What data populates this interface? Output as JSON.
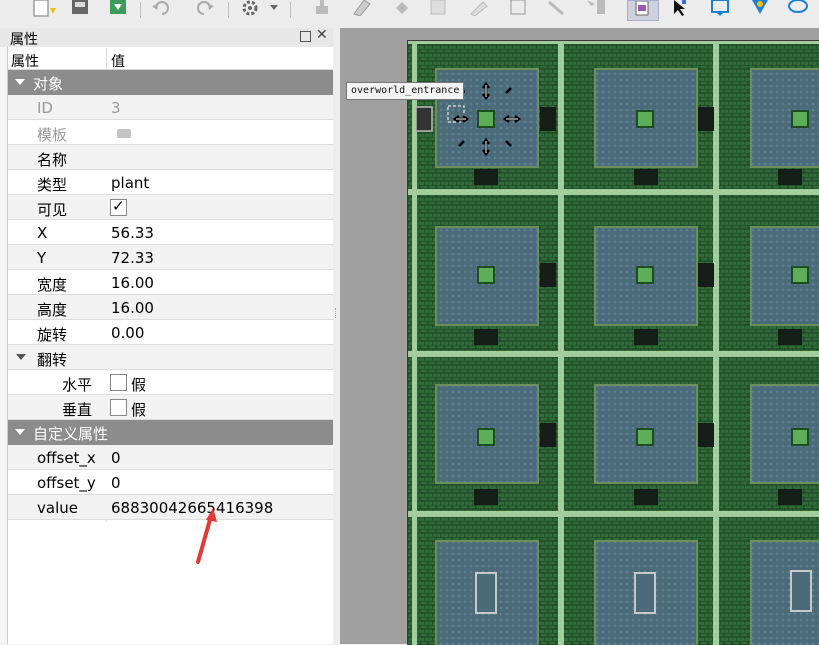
{
  "dock": {
    "title": "属性",
    "close_glyph": "✕",
    "header": {
      "prop": "属性",
      "value": "值"
    }
  },
  "groups": {
    "object": "对象",
    "flip": "翻转",
    "custom": "自定义属性"
  },
  "properties": {
    "id": {
      "name": "ID",
      "value": "3"
    },
    "template": {
      "name": "模板"
    },
    "name": {
      "name": "名称",
      "value": ""
    },
    "type": {
      "name": "类型",
      "value": "plant"
    },
    "visible": {
      "name": "可见",
      "checked": true
    },
    "x": {
      "name": "X",
      "value": "56.33"
    },
    "y": {
      "name": "Y",
      "value": "72.33"
    },
    "width": {
      "name": "宽度",
      "value": "16.00"
    },
    "height": {
      "name": "高度",
      "value": "16.00"
    },
    "rotation": {
      "name": "旋转",
      "value": "0.00"
    },
    "flip_h": {
      "name": "水平",
      "checked": false,
      "text": "假"
    },
    "flip_v": {
      "name": "垂直",
      "checked": false,
      "text": "假"
    },
    "offset_x": {
      "name": "offset_x",
      "value": "0"
    },
    "offset_y": {
      "name": "offset_y",
      "value": "0"
    },
    "value": {
      "name": "value",
      "value": "68830042665416398"
    }
  },
  "map": {
    "object_label": "overworld_entrance"
  },
  "toolbar_icons": [
    "new-file-icon",
    "save-icon",
    "export-icon",
    "undo-icon",
    "redo-icon",
    "command-gear-icon",
    "dropdown-icon",
    "stamp-icon",
    "eraser-icon",
    "fill-icon",
    "rect-select-icon",
    "magic-wand-icon",
    "select-same-icon",
    "tile-stamp-icon",
    "object-select-icon",
    "rectangle-icon",
    "point-icon",
    "ellipse-icon"
  ],
  "colors": {
    "group_bg": "#8c8c8c",
    "accent_arrow": "#e53935",
    "room_floor": "#4b6a7a",
    "wall_green": "#2f7a38"
  }
}
